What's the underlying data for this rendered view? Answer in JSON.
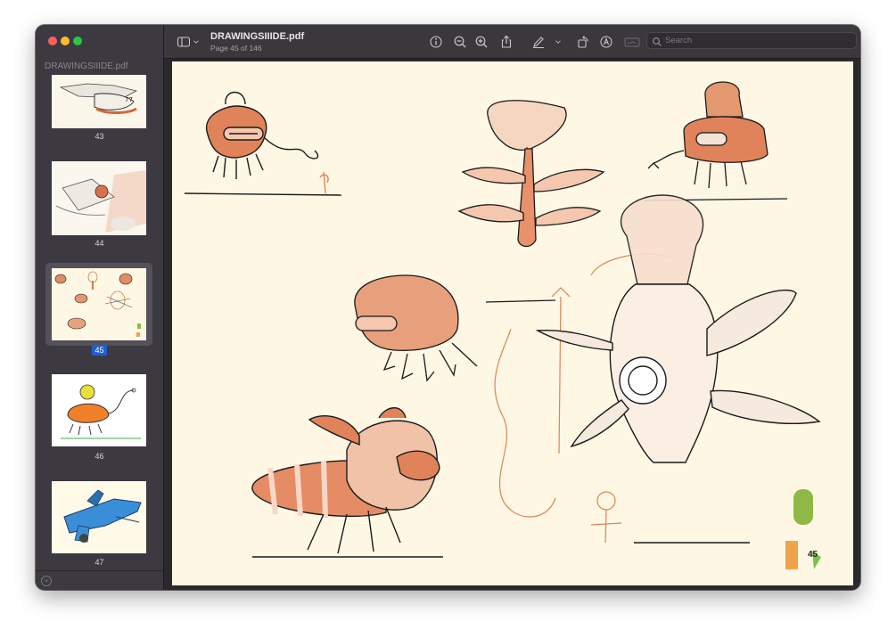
{
  "window": {
    "sidebar_title": "DRAWINGSIIIDE.pdf",
    "title": "DRAWINGSIIIDE.pdf",
    "subtitle": "Page 45 of 146"
  },
  "sidebar": {
    "thumbnails": [
      {
        "label": "43",
        "selected": false
      },
      {
        "label": "44",
        "selected": false
      },
      {
        "label": "45",
        "selected": true
      },
      {
        "label": "46",
        "selected": false
      },
      {
        "label": "47",
        "selected": false
      }
    ]
  },
  "toolbar": {
    "icons": [
      "sidebar-toggle-icon",
      "chevron-down-icon",
      "info-icon",
      "zoom-out-icon",
      "zoom-in-icon",
      "share-icon",
      "markup-pen-icon",
      "chevron-down-icon",
      "rotate-icon",
      "annotate-icon",
      "sign-icon"
    ],
    "search_placeholder": "Search"
  },
  "page": {
    "page_number": "45"
  },
  "colors": {
    "sidebar_bg": "#3d3940",
    "toolbar_bg": "#3a373d",
    "page_bg": "#fdf7e4",
    "selection": "#1f5fd0",
    "sketch_orange": "#e0835a",
    "sketch_ink": "#1a1a1a"
  }
}
